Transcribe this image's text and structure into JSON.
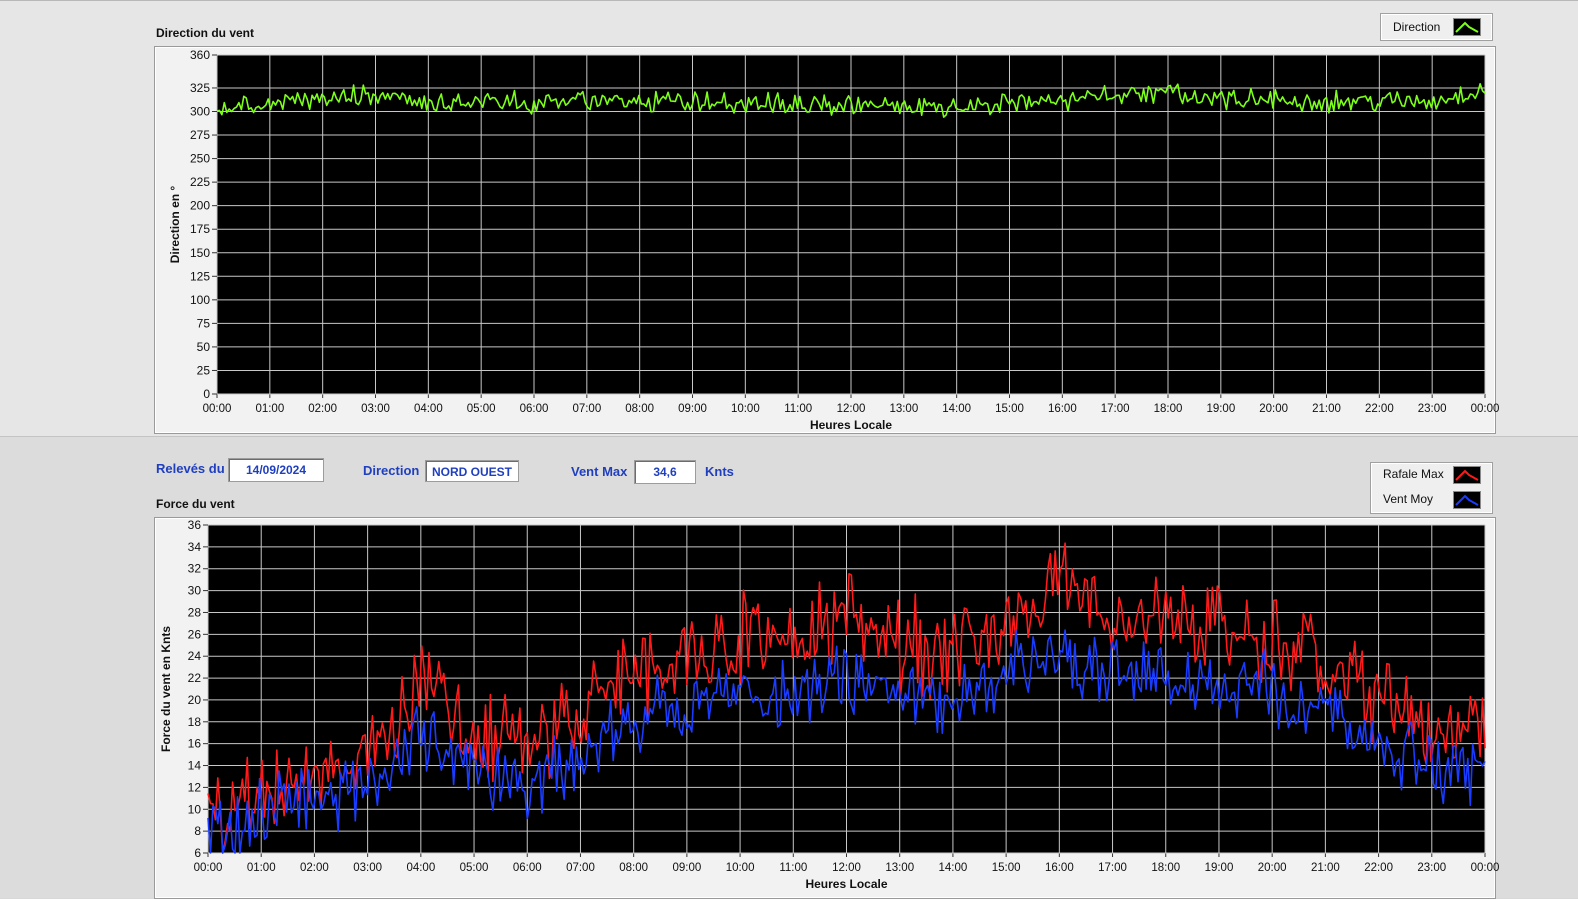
{
  "info": {
    "releves_label": "Relevés du",
    "date": "14/09/2024",
    "direction_label": "Direction",
    "direction_value": "NORD OUEST",
    "vent_max_label": "Vent Max",
    "vent_max_value": "34,6",
    "unit": "Knts"
  },
  "colors": {
    "direction": "#7cff1a",
    "rafale": "#ff1a1a",
    "vent_moy": "#1a3cff",
    "plot_bg": "#000000",
    "grid": "#c8c8c8",
    "label_blue": "#1f3fbf"
  },
  "chart_data": [
    {
      "type": "line",
      "title": "Direction du vent",
      "xlabel": "Heures Locale",
      "ylabel": "Direction en °",
      "xlim": [
        "00:00",
        "00:00"
      ],
      "ylim": [
        0,
        360
      ],
      "yticks": [
        "0",
        "25",
        "50",
        "75",
        "100",
        "125",
        "150",
        "175",
        "200",
        "225",
        "250",
        "275",
        "300",
        "325",
        "360"
      ],
      "x": [
        "00:00",
        "01:00",
        "02:00",
        "03:00",
        "04:00",
        "05:00",
        "06:00",
        "07:00",
        "08:00",
        "09:00",
        "10:00",
        "11:00",
        "12:00",
        "13:00",
        "14:00",
        "15:00",
        "16:00",
        "17:00",
        "18:00",
        "19:00",
        "20:00",
        "21:00",
        "22:00",
        "23:00",
        "00:00"
      ],
      "grid": true,
      "legend": "top-right",
      "series": [
        {
          "name": "Direction",
          "values": [
            300,
            308,
            314,
            316,
            307,
            312,
            310,
            312,
            308,
            309,
            311,
            308,
            307,
            305,
            304,
            308,
            312,
            318,
            320,
            314,
            312,
            311,
            311,
            310,
            325
          ]
        }
      ]
    },
    {
      "type": "line",
      "title": "Force du vent",
      "xlabel": "Heures Locale",
      "ylabel": "Force du vent en Knts",
      "xlim": [
        "00:00",
        "00:00"
      ],
      "ylim": [
        6,
        36
      ],
      "yticks": [
        "6",
        "8",
        "10",
        "12",
        "14",
        "16",
        "18",
        "20",
        "22",
        "24",
        "26",
        "28",
        "30",
        "32",
        "34",
        "36"
      ],
      "x": [
        "00:00",
        "01:00",
        "02:00",
        "03:00",
        "04:00",
        "05:00",
        "06:00",
        "07:00",
        "08:00",
        "09:00",
        "10:00",
        "11:00",
        "12:00",
        "13:00",
        "14:00",
        "15:00",
        "16:00",
        "17:00",
        "18:00",
        "19:00",
        "20:00",
        "21:00",
        "22:00",
        "23:00",
        "00:00"
      ],
      "grid": true,
      "legend": "top-right",
      "series": [
        {
          "name": "Rafale Max",
          "values": [
            10,
            11.5,
            13.5,
            15,
            21,
            17,
            16,
            19,
            23,
            24,
            26,
            25,
            27,
            25,
            24,
            28,
            30,
            29,
            28,
            27,
            25,
            24,
            20,
            17,
            17
          ]
        },
        {
          "name": "Vent Moy",
          "values": [
            8,
            9.5,
            11,
            12,
            17,
            14,
            12,
            15,
            18.5,
            19,
            21,
            20,
            22,
            20.5,
            19.5,
            23,
            24,
            22,
            22,
            21.5,
            21,
            19,
            16,
            14,
            13.5
          ]
        }
      ]
    }
  ]
}
